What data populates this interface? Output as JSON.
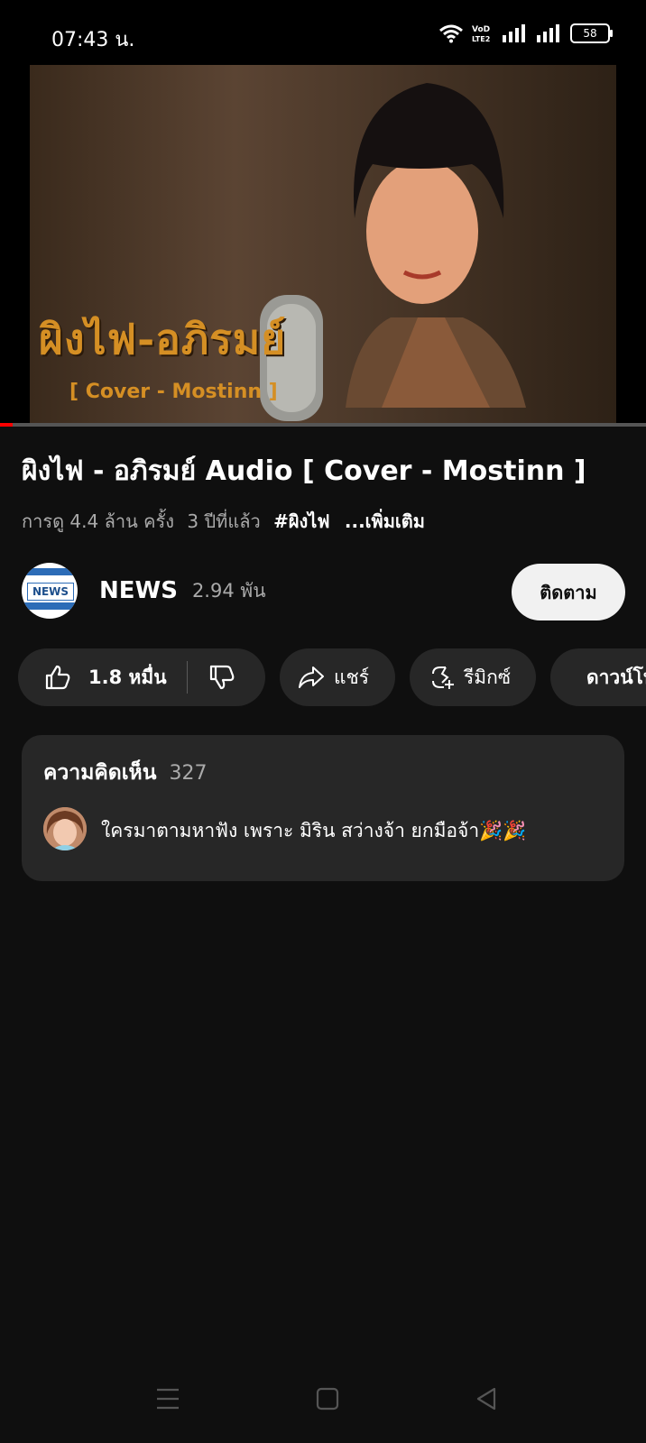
{
  "status_bar": {
    "time": "07:43 น.",
    "battery": "58"
  },
  "video": {
    "thumbnail_title": "ผิงไฟ-อภิรมย์",
    "thumbnail_subtitle": "[ Cover - Mostinn ]",
    "progress_fraction": 0.02
  },
  "title": "ผิงไฟ - อภิรมย์ Audio [ Cover - Mostinn ]",
  "meta": {
    "views": "การดู 4.4 ล้าน ครั้ง",
    "age": "3 ปีที่แล้ว",
    "hashtag": "#ผิงไฟ",
    "more": "...เพิ่มเติม"
  },
  "channel": {
    "avatar_text": "NEWS",
    "name": "NEWS",
    "subscribers": "2.94 พัน",
    "subscribe_label": "ติดตาม"
  },
  "actions": {
    "like_count": "1.8 หมื่น",
    "share": "แชร์",
    "remix": "รีมิกซ์",
    "download": "ดาวน์โหลด"
  },
  "comments": {
    "heading": "ความคิดเห็น",
    "count": "327",
    "top_comment": "ใครมาตามหาฟัง เพราะ มิริน สว่างจ้า ยกมือจ้า🎉🎉"
  },
  "icons": {
    "wifi": "wifi-icon",
    "signal": "signal-icon",
    "like": "thumb-up-icon",
    "dislike": "thumb-down-icon",
    "share": "share-arrow-icon",
    "remix": "remix-icon",
    "download": "download-icon",
    "menu": "menu-icon",
    "home": "home-square-icon",
    "back": "back-triangle-icon"
  },
  "colors": {
    "background": "#0f0f0f",
    "pill": "#272727",
    "progress": "#ff0000",
    "thumbnail_text": "#d58f24"
  }
}
